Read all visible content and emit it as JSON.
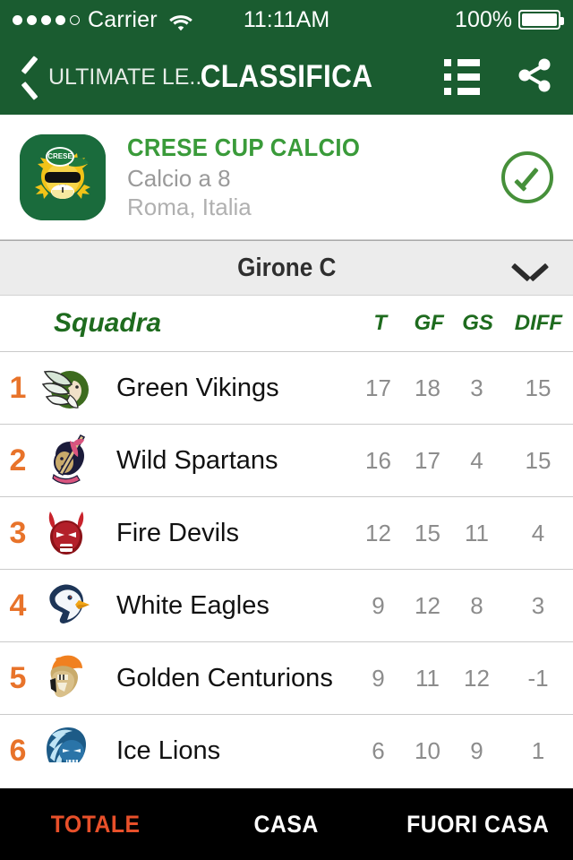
{
  "status_bar": {
    "signal_dots_filled": 4,
    "signal_dots_total": 5,
    "carrier": "Carrier",
    "wifi_icon": "wifi-icon",
    "time": "11:11AM",
    "battery_percent": "100%",
    "battery_icon": "battery-full-icon"
  },
  "navbar": {
    "back_icon": "chevron-left-icon",
    "back_label": "ULTIMATE LE...",
    "title": "CLASSIFICA",
    "list_icon": "list-icon",
    "share_icon": "share-icon",
    "background_color": "#1a5c30"
  },
  "league": {
    "logo_icon": "league-logo-lion-icon",
    "name": "CRESE CUP CALCIO",
    "format": "Calcio a 8",
    "location": "Roma, Italia",
    "verified_icon": "check-circle-icon",
    "name_color": "#3a9b3a",
    "verified_color": "#46903a"
  },
  "girone_selector": {
    "label": "Girone C",
    "chevron_icon": "chevron-down-icon"
  },
  "standings": {
    "columns": {
      "team": "Squadra",
      "t": "T",
      "gf": "GF",
      "gs": "GS",
      "diff": "DIFF"
    },
    "header_color": "#1e6b1e",
    "rank_color": "#e8732a",
    "rows": [
      {
        "rank": "1",
        "logo_icon": "team-logo-green-vikings",
        "team": "Green Vikings",
        "t": "17",
        "gf": "18",
        "gs": "3",
        "diff": "15"
      },
      {
        "rank": "2",
        "logo_icon": "team-logo-wild-spartans",
        "team": "Wild Spartans",
        "t": "16",
        "gf": "17",
        "gs": "4",
        "diff": "15"
      },
      {
        "rank": "3",
        "logo_icon": "team-logo-fire-devils",
        "team": "Fire Devils",
        "t": "12",
        "gf": "15",
        "gs": "11",
        "diff": "4"
      },
      {
        "rank": "4",
        "logo_icon": "team-logo-white-eagles",
        "team": "White Eagles",
        "t": "9",
        "gf": "12",
        "gs": "8",
        "diff": "3"
      },
      {
        "rank": "5",
        "logo_icon": "team-logo-golden-centurions",
        "team": "Golden Centurions",
        "t": "9",
        "gf": "11",
        "gs": "12",
        "diff": "-1"
      },
      {
        "rank": "6",
        "logo_icon": "team-logo-ice-lions",
        "team": "Ice Lions",
        "t": "6",
        "gf": "10",
        "gs": "9",
        "diff": "1"
      }
    ]
  },
  "tabbar": {
    "background_color": "#000000",
    "active_color": "#e8502a",
    "tabs": [
      {
        "label": "TOTALE",
        "active": true
      },
      {
        "label": "CASA",
        "active": false
      },
      {
        "label": "FUORI CASA",
        "active": false
      }
    ]
  }
}
